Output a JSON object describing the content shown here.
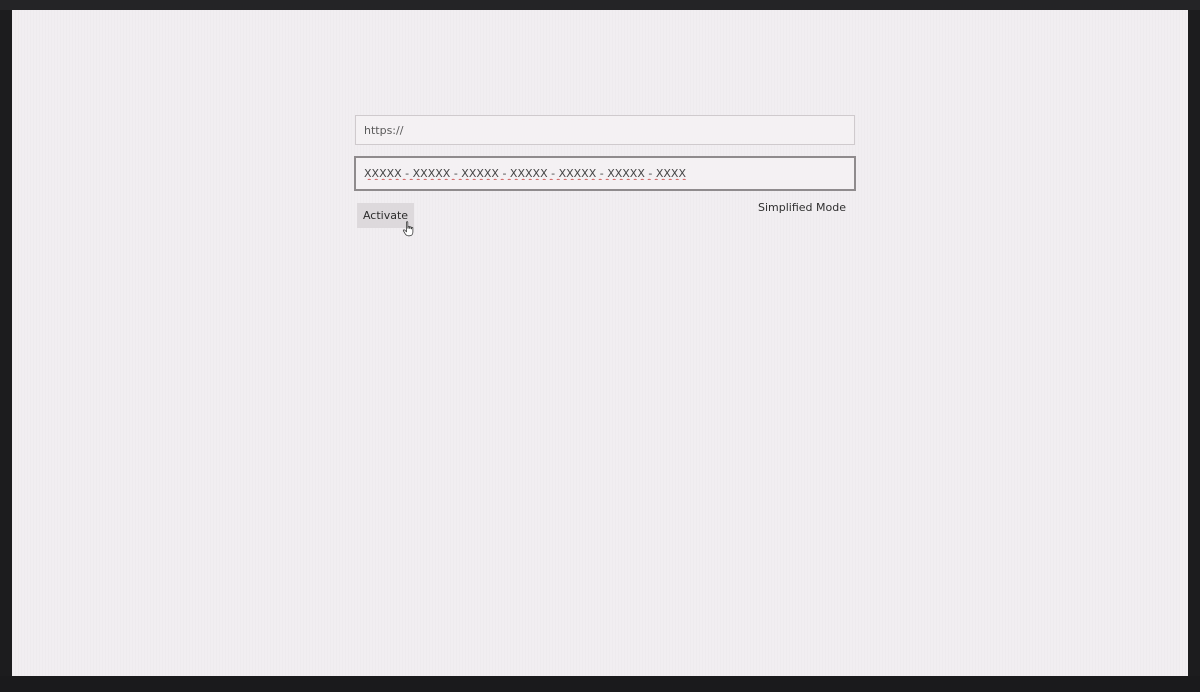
{
  "activation": {
    "url_value": "https://",
    "key_value": "XXXXX - XXXXX - XXXXX - XXXXX - XXXXX - XXXXX - XXXX",
    "activate_label": "Activate",
    "simplified_mode_label": "Simplified Mode"
  },
  "cursor_icon": "hand-pointer-icon"
}
